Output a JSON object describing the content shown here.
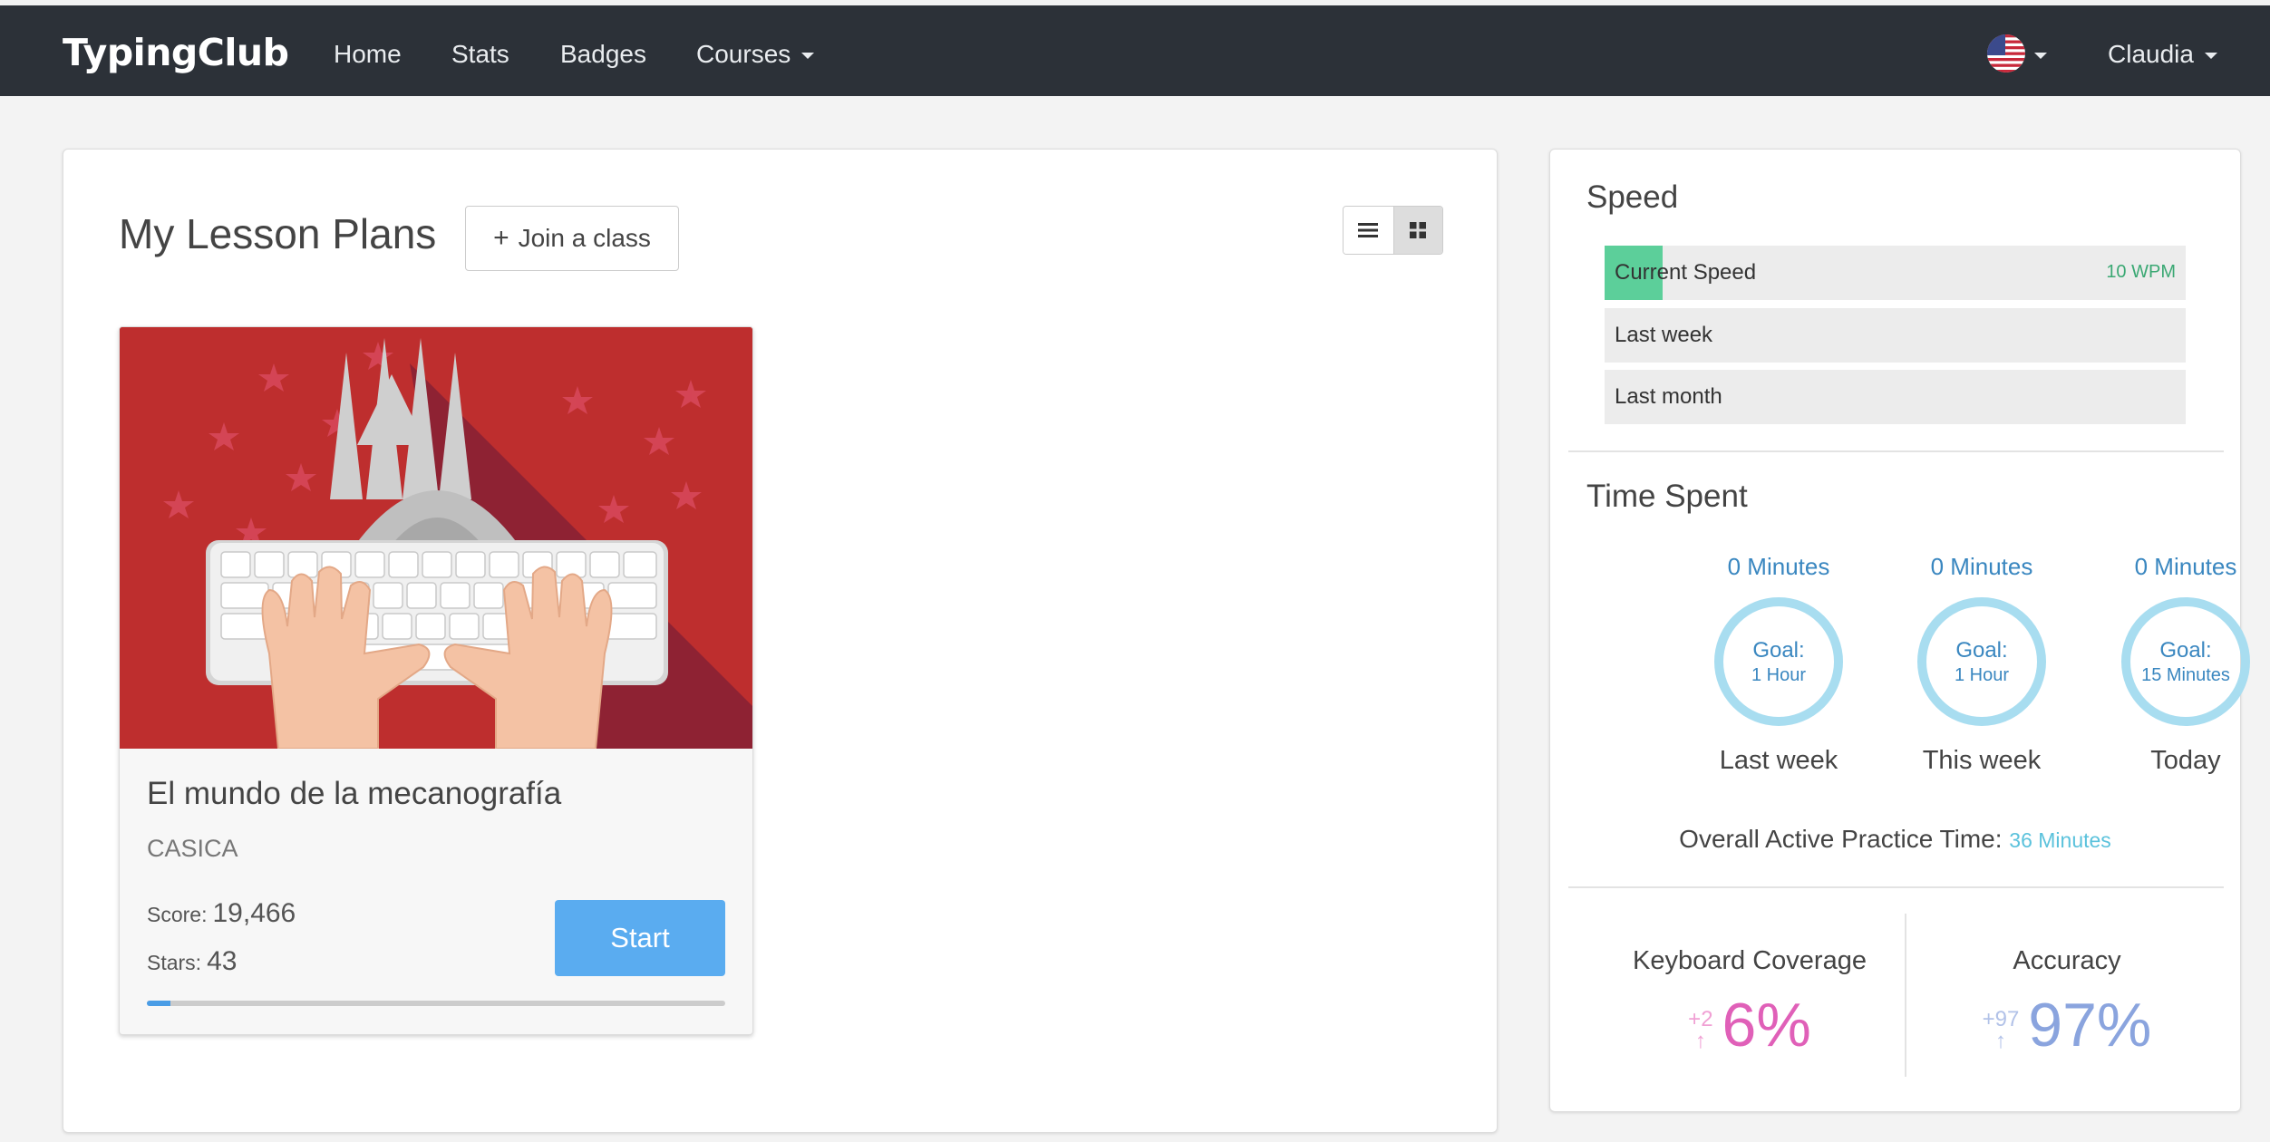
{
  "navbar": {
    "brand": "TypingClub",
    "items": [
      "Home",
      "Stats",
      "Badges",
      "Courses"
    ],
    "user": "Claudia"
  },
  "lessons": {
    "title": "My Lesson Plans",
    "join_label": "Join a class",
    "card": {
      "title": "El mundo de la mecanografía",
      "subtitle": "CASICA",
      "score_label": "Score:",
      "score": "19,466",
      "stars_label": "Stars:",
      "stars": "43",
      "start_label": "Start",
      "progress": 0.04
    }
  },
  "speed": {
    "title": "Speed",
    "rows": [
      {
        "label": "Current Speed",
        "value": "10 WPM",
        "fill": 0.1
      },
      {
        "label": "Last week",
        "value": "",
        "fill": 0
      },
      {
        "label": "Last month",
        "value": "",
        "fill": 0
      }
    ]
  },
  "time_spent": {
    "title": "Time Spent",
    "columns": [
      {
        "minutes": "0 Minutes",
        "goal_label": "Goal:",
        "goal": "1 Hour",
        "label": "Last week"
      },
      {
        "minutes": "0 Minutes",
        "goal_label": "Goal:",
        "goal": "1 Hour",
        "label": "This week"
      },
      {
        "minutes": "0 Minutes",
        "goal_label": "Goal:",
        "goal": "15 Minutes",
        "label": "Today"
      }
    ],
    "overall_label": "Overall Active Practice Time:",
    "overall_value": "36 Minutes"
  },
  "keyboard_coverage": {
    "title": "Keyboard Coverage",
    "delta": "+2",
    "value": "6%",
    "color": "#e060b8"
  },
  "accuracy": {
    "title": "Accuracy",
    "delta": "+97",
    "value": "97%",
    "color": "#8aa4de"
  },
  "icons": [
    "flag-us-icon",
    "caret-down-icon",
    "plus-icon",
    "list-view-icon",
    "grid-view-icon",
    "arrow-up-icon"
  ]
}
